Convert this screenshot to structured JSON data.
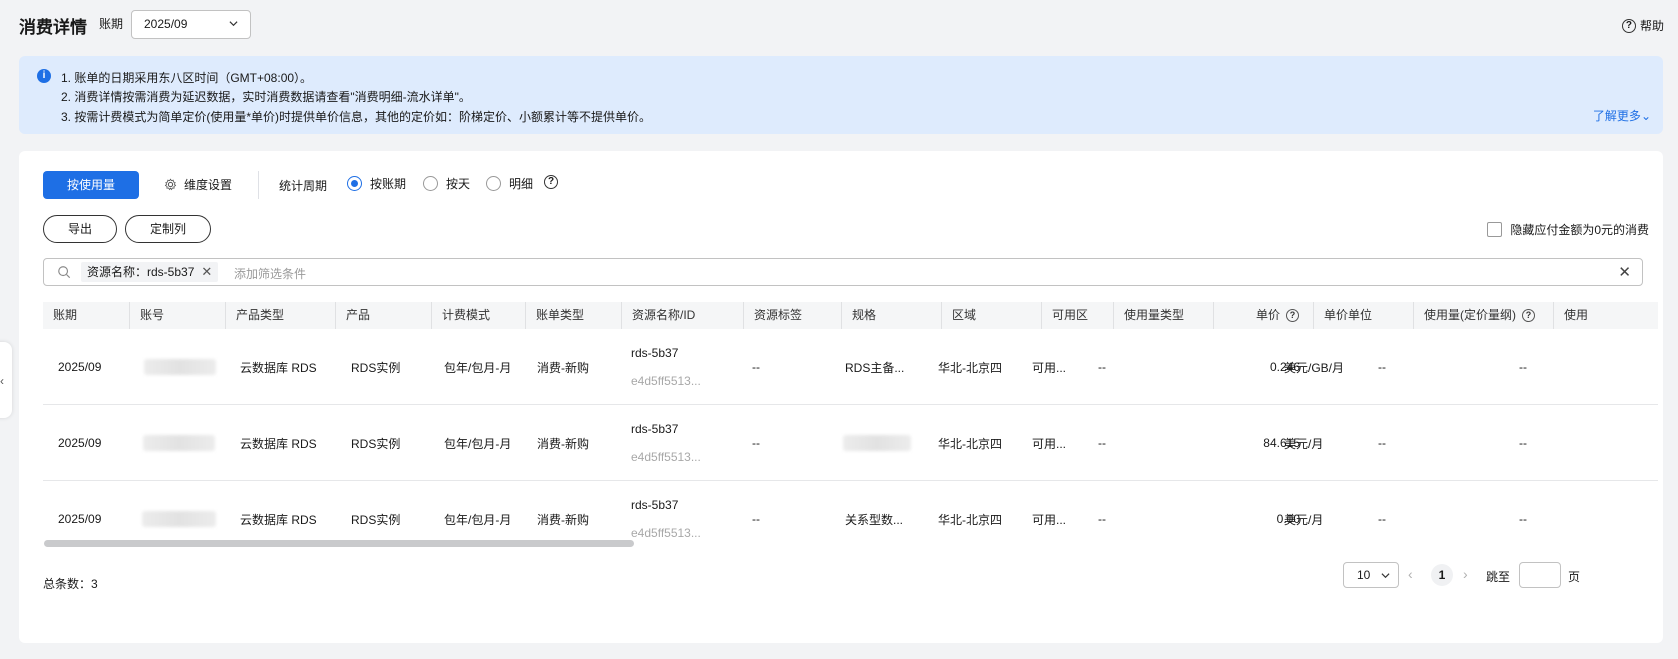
{
  "header": {
    "title": "消费详情",
    "period_label": "账期",
    "period_value": "2025/09",
    "help_label": "帮助"
  },
  "notice": {
    "lines": [
      "1. 账单的日期采用东八区时间（GMT+08:00）。",
      "2. 消费详情按需消费为延迟数据，实时消费数据请查看\"消费明细-流水详单\"。",
      "3. 按需计费模式为简单定价(使用量*单价)时提供单价信息，其他的定价如：阶梯定价、小额累计等不提供单价。"
    ],
    "more_label": "了解更多"
  },
  "toolbar": {
    "by_usage_label": "按使用量",
    "dimension_settings_label": "维度设置",
    "stat_period_label": "统计周期",
    "radios": [
      "按账期",
      "按天",
      "明细"
    ],
    "selected_radio": "按账期",
    "export_label": "导出",
    "custom_columns_label": "定制列",
    "hide_zero_label": "隐藏应付金额为0元的消费"
  },
  "search": {
    "chip_label": "资源名称：rds-5b37",
    "placeholder": "添加筛选条件"
  },
  "table": {
    "columns": [
      "账期",
      "账号",
      "产品类型",
      "产品",
      "计费模式",
      "账单类型",
      "资源名称/ID",
      "资源标签",
      "规格",
      "区域",
      "可用区",
      "使用量类型",
      "单价",
      "单价单位",
      "使用量(定价量纲)",
      "使用"
    ],
    "rows": [
      {
        "period": "2025/09",
        "product_type": "云数据库 RDS",
        "product": "RDS实例",
        "billing_mode": "包年/包月-月",
        "bill_type": "消费-新购",
        "resource_name": "rds-5b37",
        "resource_id": "e4d5ff5513...",
        "tags": "--",
        "spec": "RDS主备...",
        "region": "华北-北京四",
        "az": "可用...",
        "usage_type": "--",
        "unit_price": "0.246",
        "price_unit": "美元/GB/月",
        "usage": "--",
        "usage2": "--"
      },
      {
        "period": "2025/09",
        "product_type": "云数据库 RDS",
        "product": "RDS实例",
        "billing_mode": "包年/包月-月",
        "bill_type": "消费-新购",
        "resource_name": "rds-5b37",
        "resource_id": "e4d5ff5513...",
        "tags": "--",
        "spec": "",
        "region": "华北-北京四",
        "az": "可用...",
        "usage_type": "--",
        "unit_price": "84.615",
        "price_unit": "美元/月",
        "usage": "--",
        "usage2": "--"
      },
      {
        "period": "2025/09",
        "product_type": "云数据库 RDS",
        "product": "RDS实例",
        "billing_mode": "包年/包月-月",
        "bill_type": "消费-新购",
        "resource_name": "rds-5b37",
        "resource_id": "e4d5ff5513...",
        "tags": "--",
        "spec": "关系型数...",
        "region": "华北-北京四",
        "az": "可用...",
        "usage_type": "--",
        "unit_price": "0.00",
        "price_unit": "美元/月",
        "usage": "--",
        "usage2": "--"
      }
    ]
  },
  "footer": {
    "total_label": "总条数：3",
    "page_size": "10",
    "current_page": "1",
    "jump_label": "跳至",
    "page_unit": "页"
  }
}
